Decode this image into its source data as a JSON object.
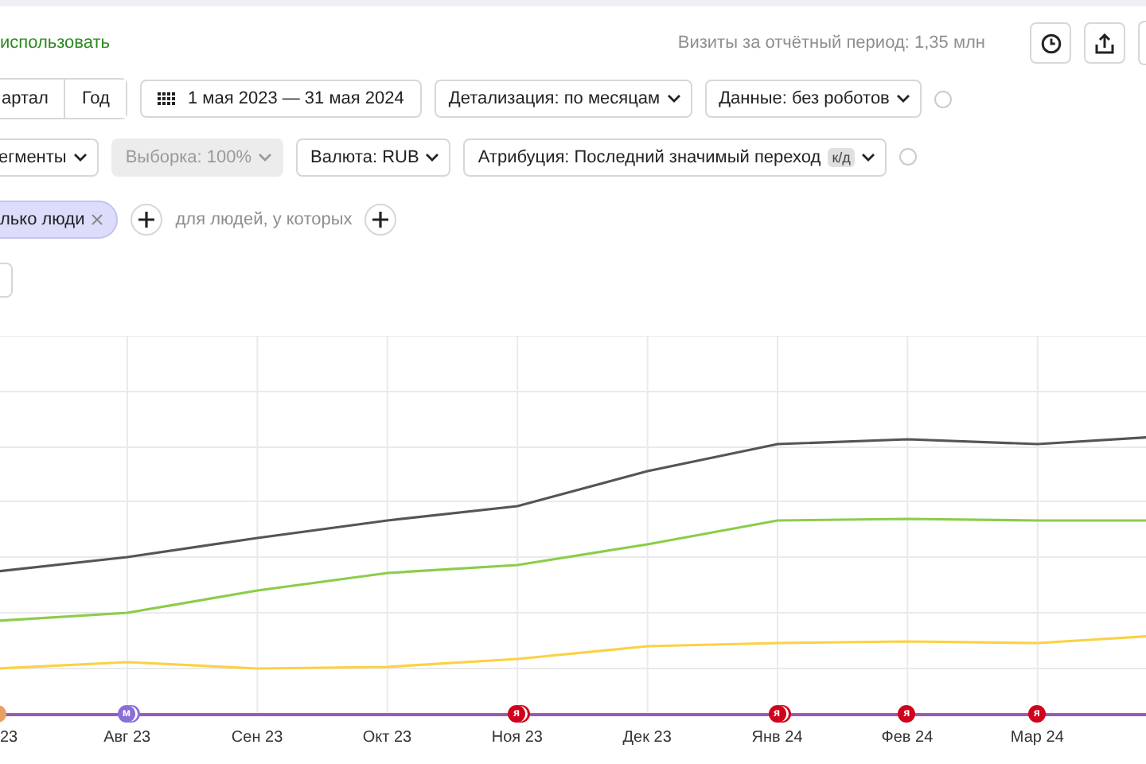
{
  "header": {
    "link": "использовать",
    "visits": "Визиты за отчётный период: 1,35 млн"
  },
  "period_tabs": [
    {
      "label": "артал",
      "selected": false
    },
    {
      "label": "Год",
      "selected": false
    }
  ],
  "date_range": "1 мая 2023 — 31 мая 2024",
  "filters_row1": [
    {
      "label": "Детализация: по месяцам",
      "disabled": false
    },
    {
      "label": "Данные: без роботов",
      "disabled": false,
      "help": true
    }
  ],
  "filters_row2": [
    {
      "label": "егменты",
      "disabled": false
    },
    {
      "label": "Выборка: 100%",
      "disabled": true
    },
    {
      "label": "Валюта: RUB",
      "disabled": false
    },
    {
      "label": "Атрибуция: Последний значимый переход",
      "tag": "к/д",
      "disabled": false,
      "help": true
    }
  ],
  "segment": {
    "chip": "лько люди",
    "people_text": "для людей, у которых"
  },
  "chart": {
    "months": [
      {
        "label": "23",
        "marker": {
          "kind": "single",
          "color": "#e8a060"
        }
      },
      {
        "label": "Авг 23",
        "marker": {
          "kind": "stack",
          "color": "#8a6fd6",
          "label": "м"
        }
      },
      {
        "label": "Сен 23"
      },
      {
        "label": "Окт 23"
      },
      {
        "label": "Ноя 23",
        "marker": {
          "kind": "stack",
          "color": "#d0021b",
          "label": "я"
        }
      },
      {
        "label": "Дек 23"
      },
      {
        "label": "Янв 24",
        "marker": {
          "kind": "stack",
          "color": "#d0021b",
          "label": "я"
        }
      },
      {
        "label": "Фев 24",
        "marker": {
          "kind": "single",
          "color": "#d0021b",
          "label": "я"
        }
      },
      {
        "label": "Мар 24",
        "marker": {
          "kind": "single",
          "color": "#d0021b",
          "label": "я"
        }
      }
    ]
  }
}
